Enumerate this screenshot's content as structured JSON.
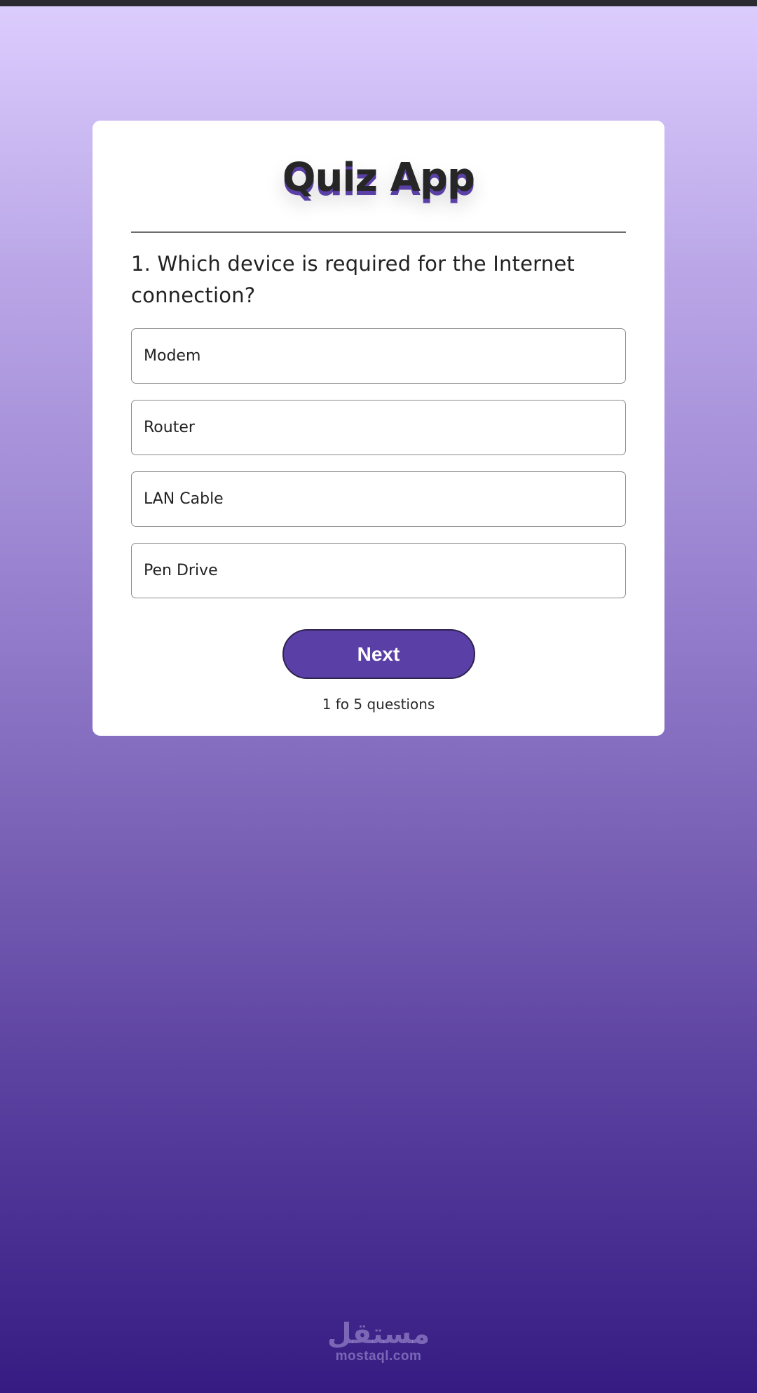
{
  "app": {
    "title": "Quiz App"
  },
  "quiz": {
    "question": "1. Which device is required for the Internet connection?",
    "options": [
      "Modem",
      "Router",
      "LAN Cable",
      "Pen Drive"
    ],
    "next_label": "Next",
    "progress_text": "1 fo 5 questions"
  },
  "watermark": {
    "arabic": "مستقل",
    "latin": "mostaql.com"
  },
  "colors": {
    "accent": "#5a3fa6",
    "background_top": "#dccdfe",
    "background_bottom": "#361c82",
    "card": "#ffffff"
  }
}
